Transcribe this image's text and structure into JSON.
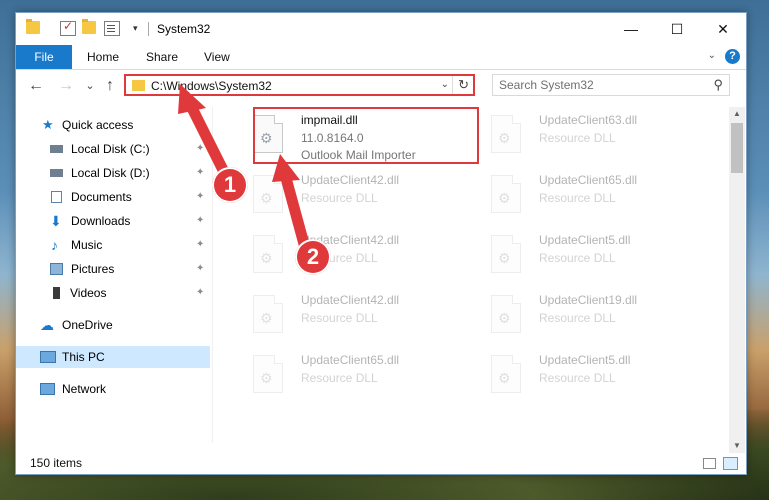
{
  "window": {
    "title": "System32",
    "minimize_glyph": "—",
    "maximize_glyph": "☐",
    "close_glyph": "✕"
  },
  "ribbon": {
    "file": "File",
    "home": "Home",
    "share": "Share",
    "view": "View",
    "collapse_glyph": "⌄",
    "help_glyph": "?"
  },
  "nav": {
    "back_glyph": "←",
    "forward_glyph": "→",
    "recent_glyph": "⌄",
    "up_glyph": "↑",
    "address": "C:\\Windows\\System32",
    "address_drop_glyph": "⌄",
    "refresh_glyph": "↻",
    "search_placeholder": "Search System32",
    "search_glyph": "⚲"
  },
  "sidebar": {
    "items": [
      {
        "label": "Quick access",
        "icon": "star-icon",
        "pinned": false
      },
      {
        "label": "Local Disk (C:)",
        "icon": "drive-icon",
        "pinned": true
      },
      {
        "label": "Local Disk (D:)",
        "icon": "drive-icon",
        "pinned": true
      },
      {
        "label": "Documents",
        "icon": "documents-icon",
        "pinned": true
      },
      {
        "label": "Downloads",
        "icon": "download-icon",
        "pinned": true
      },
      {
        "label": "Music",
        "icon": "music-icon",
        "pinned": true
      },
      {
        "label": "Pictures",
        "icon": "pictures-icon",
        "pinned": true
      },
      {
        "label": "Videos",
        "icon": "videos-icon",
        "pinned": true
      },
      {
        "label": "OneDrive",
        "icon": "cloud-icon",
        "pinned": false
      },
      {
        "label": "This PC",
        "icon": "computer-icon",
        "pinned": false,
        "selected": true
      },
      {
        "label": "Network",
        "icon": "network-icon",
        "pinned": false
      }
    ],
    "pin_glyph": "📌"
  },
  "files": {
    "highlighted": {
      "name": "impmail.dll",
      "version": "11.0.8164.0",
      "description": "Outlook Mail Importer"
    },
    "items": [
      {
        "name": "UpdateClient63.dll",
        "description": "Resource DLL"
      },
      {
        "name": "UpdateClient42.dll",
        "description": "Resource DLL"
      },
      {
        "name": "UpdateClient65.dll",
        "description": "Resource DLL"
      },
      {
        "name": "UpdateClient42.dll",
        "description": "Resource DLL"
      },
      {
        "name": "UpdateClient5.dll",
        "description": "Resource DLL"
      },
      {
        "name": "UpdateClient42.dll",
        "description": "Resource DLL"
      },
      {
        "name": "UpdateClient19.dll",
        "description": "Resource DLL"
      },
      {
        "name": "UpdateClient65.dll",
        "description": "Resource DLL"
      },
      {
        "name": "UpdateClient5.dll",
        "description": "Resource DLL"
      }
    ],
    "gear_glyph": "⚙"
  },
  "status": {
    "item_count": "150 items"
  },
  "scroll": {
    "up_glyph": "▲",
    "down_glyph": "▼"
  },
  "annotations": {
    "badge_1": "1",
    "badge_2": "2",
    "color": "#e0393c"
  },
  "colors": {
    "accent": "#1979ca",
    "selection": "#cde8ff"
  }
}
